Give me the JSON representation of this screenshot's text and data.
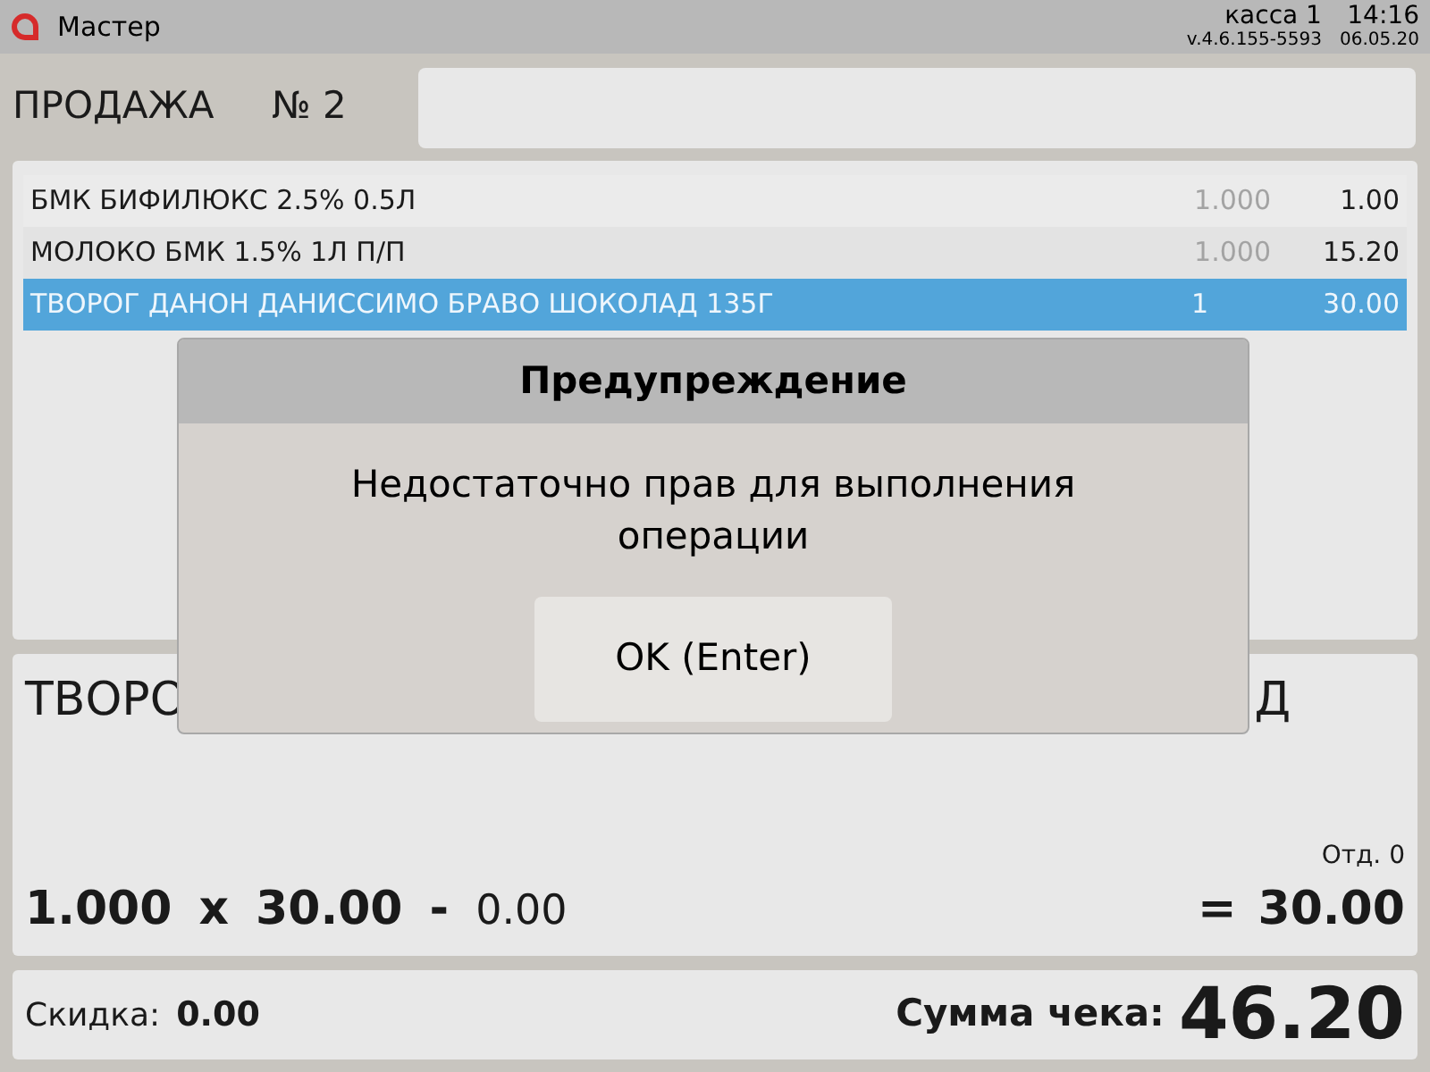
{
  "title_bar": {
    "app_name": "Мастер",
    "register": "касса 1",
    "version": "v.4.6.155-5593",
    "time": "14:16",
    "date": "06.05.20"
  },
  "sale": {
    "title": "ПРОДАЖА",
    "number": "№ 2"
  },
  "items": [
    {
      "name": "БМК БИФИЛЮКС 2.5% 0.5Л",
      "quantity": "1.000",
      "price": "1.00",
      "selected": false
    },
    {
      "name": "МОЛОКО БМК 1.5% 1Л П/П",
      "quantity": "1.000",
      "price": "15.20",
      "selected": false
    },
    {
      "name": "ТВОРОГ ДАНОН ДАНИССИМО БРАВО ШОКОЛАД 135Г",
      "quantity": "1",
      "price": "30.00",
      "selected": true
    }
  ],
  "current_item": {
    "name_start": "ТВОРО",
    "name_end": "Д",
    "department": "Отд. 0",
    "quantity": "1.000",
    "times": "x",
    "price": "30.00",
    "minus": "-",
    "discount": "0.00",
    "equals": "=",
    "total": "30.00"
  },
  "summary": {
    "discount_label": "Скидка:",
    "discount": "0.00",
    "total_label": "Сумма чека:",
    "total": "46.20"
  },
  "dialog": {
    "title": "Предупреждение",
    "message": "Недостаточно прав для выполнения операции",
    "button": "OK (Enter)"
  }
}
